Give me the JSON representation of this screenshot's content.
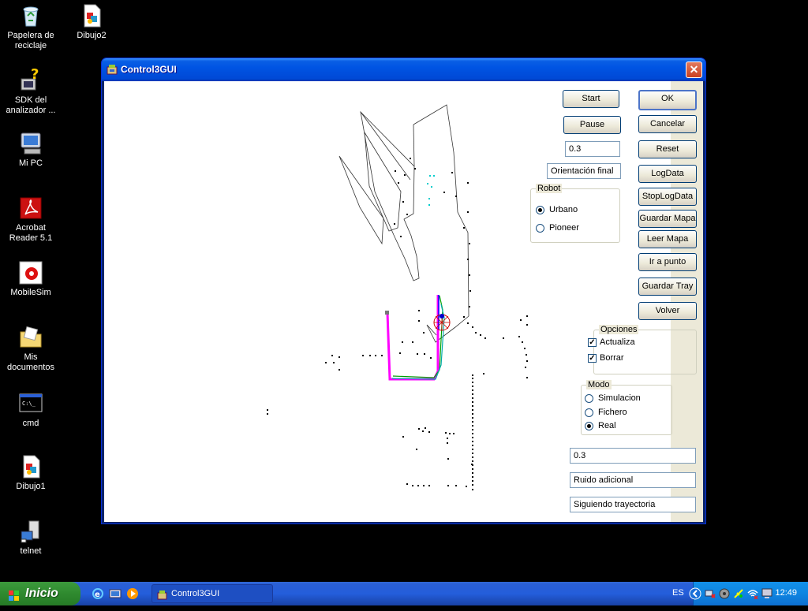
{
  "desktop": {
    "icons": [
      {
        "label": "Papelera de reciclaje",
        "icon": "recycle-bin-icon"
      },
      {
        "label": "Dibujo2",
        "icon": "image-file-icon"
      },
      {
        "label": "SDK del analizador ...",
        "icon": "sdk-icon"
      },
      {
        "label": "Mi PC",
        "icon": "computer-icon"
      },
      {
        "label": "Acrobat Reader 5.1",
        "icon": "acrobat-icon"
      },
      {
        "label": "MobileSim",
        "icon": "mobilesim-icon"
      },
      {
        "label": "Mis documentos",
        "icon": "folder-icon"
      },
      {
        "label": "cmd",
        "icon": "console-icon"
      },
      {
        "label": "Dibujo1",
        "icon": "image-file-icon"
      },
      {
        "label": "telnet",
        "icon": "telnet-icon"
      }
    ]
  },
  "window": {
    "title": "Control3GUI",
    "close_glyph": "✕",
    "buttons": {
      "start": "Start",
      "pause": "Pause",
      "ok": "OK",
      "cancel": "Cancelar",
      "reset": "Reset",
      "logdata": "LogData",
      "stoplogdata": "StopLogData",
      "guardar_mapa": "Guardar Mapa",
      "leer_mapa": "Leer Mapa",
      "ir_a_punto": "Ir a punto",
      "guardar_tray": "Guardar Tray",
      "volver": "Volver"
    },
    "fields": {
      "value_top": "0.3",
      "orientacion": "Orientación final",
      "value_bottom": "0.3",
      "ruido": "Ruido adicional",
      "status": "Siguiendo trayectoria"
    },
    "robot_group": {
      "label": "Robot",
      "options": [
        "Urbano",
        "Pioneer"
      ],
      "selected": "Urbano"
    },
    "opciones_group": {
      "label": "Opciones",
      "checks": [
        {
          "label": "Actualiza",
          "checked": true
        },
        {
          "label": "Borrar",
          "checked": true
        }
      ],
      "check_glyph": "✓"
    },
    "modo_group": {
      "label": "Modo",
      "options": [
        "Simulacion",
        "Fichero",
        "Real"
      ],
      "selected": "Real"
    }
  },
  "taskbar": {
    "start_label": "Inicio",
    "task_label": "Control3GUI",
    "language": "ES",
    "clock": "12:49"
  },
  "colors": {
    "title_blue": "#0054e3",
    "trajectory_magenta": "#ff00ff",
    "path_blue": "#0000ff",
    "path_green": "#00a000",
    "robot_red": "#cc0000",
    "scan_cyan": "#00cccc"
  }
}
